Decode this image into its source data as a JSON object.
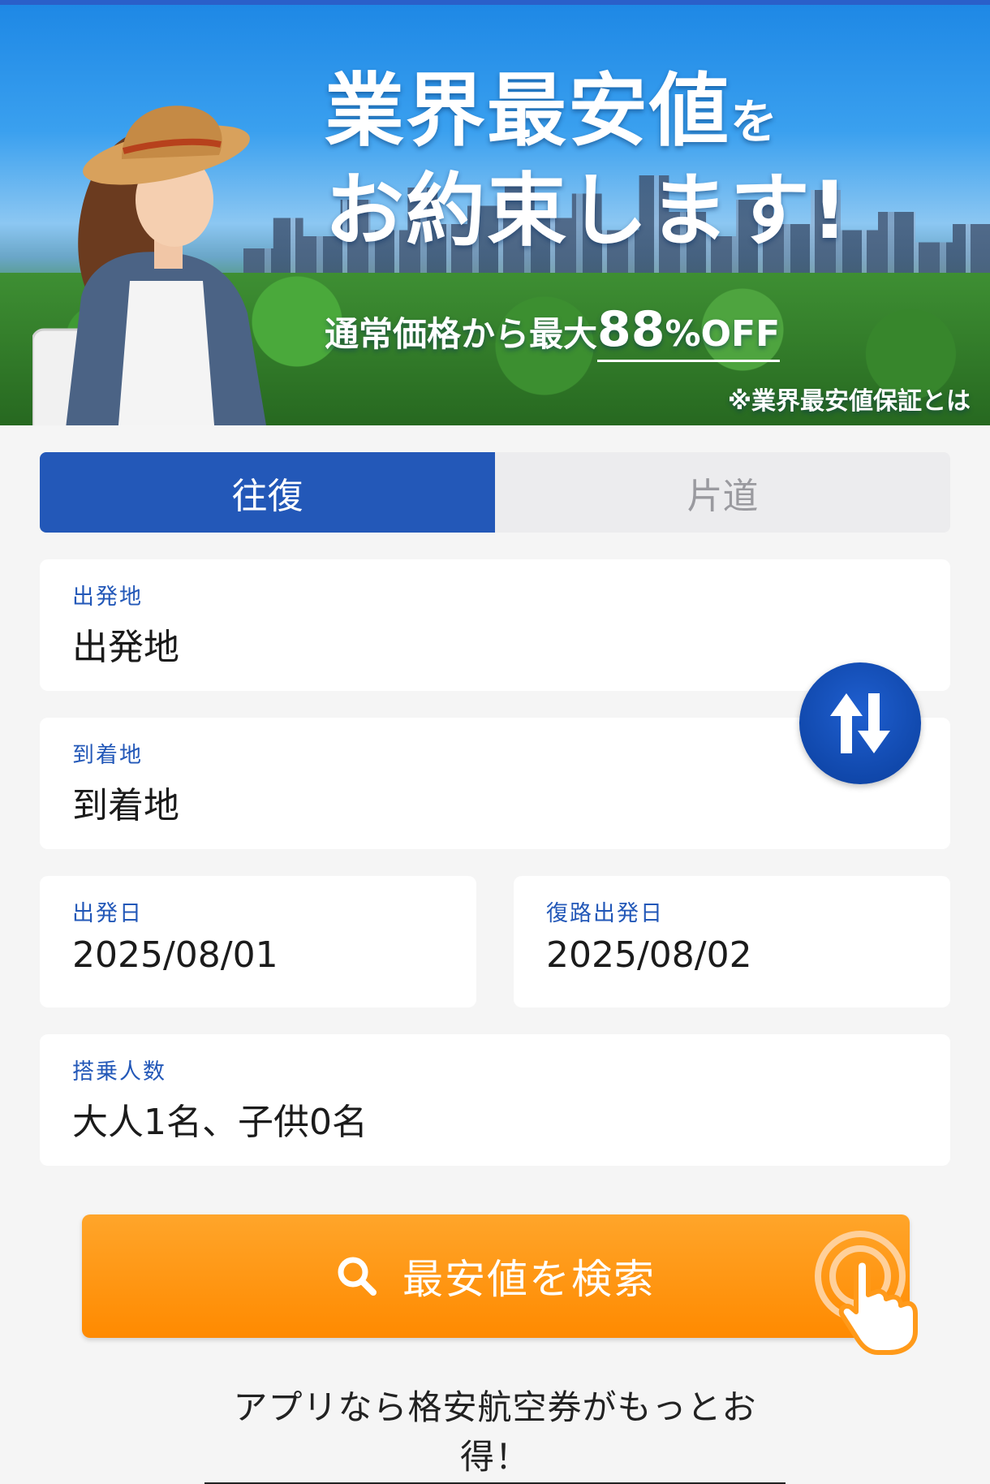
{
  "banner": {
    "headline_line1": "業界最安値",
    "headline_line1_suffix": "を",
    "headline_line2": "お約束します!",
    "sub_prefix": "通常価格から最大",
    "sub_number": "88",
    "sub_suffix": "%OFF",
    "note_link": "※業界最安値保証とは"
  },
  "trip_tabs": [
    {
      "label": "往復",
      "selected": true
    },
    {
      "label": "片道",
      "selected": false
    }
  ],
  "form": {
    "departure": {
      "label": "出発地",
      "value": "出発地"
    },
    "arrival": {
      "label": "到着地",
      "value": "到着地"
    },
    "depart_date": {
      "label": "出発日",
      "value": "2025/08/01"
    },
    "return_date": {
      "label": "復路出発日",
      "value": "2025/08/02"
    },
    "passengers": {
      "label": "搭乗人数",
      "value": "大人1名、子供0名"
    }
  },
  "search_button": {
    "label": "最安値を検索"
  },
  "app_promo": {
    "label": "アプリなら格安航空券がもっとお得！"
  },
  "colors": {
    "primary_blue": "#2358b8",
    "search_orange": "#ff9a1a",
    "background": "#f5f5f5"
  },
  "icons": [
    "swap-icon",
    "search-icon",
    "tap-pointer-icon"
  ]
}
